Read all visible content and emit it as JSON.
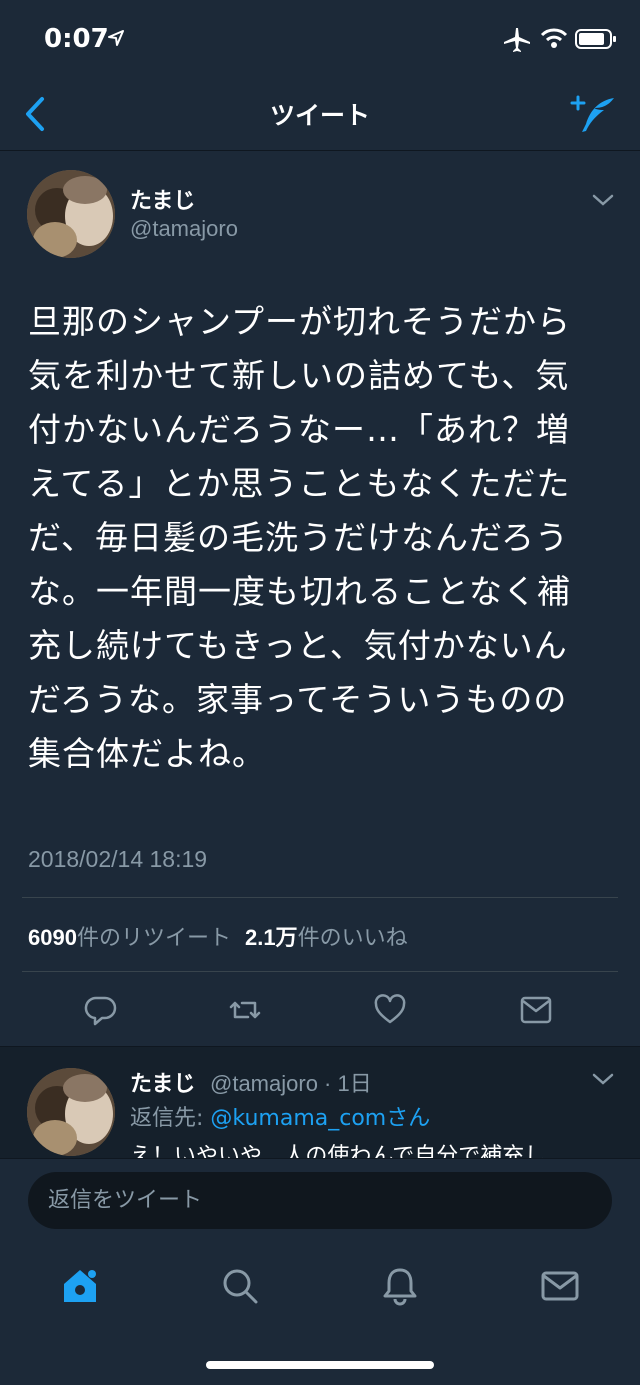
{
  "status_bar": {
    "time": "0:07"
  },
  "nav": {
    "title": "ツイート"
  },
  "tweet": {
    "author_name": "たまじ",
    "author_handle": "@tamajoro",
    "text": "旦那のシャンプーが切れそうだから気を利かせて新しいの詰めても、気付かないんだろうなー…「あれ？増えてる」とか思うこともなくただただ、毎日髪の毛洗うだけなんだろうな。一年間一度も切れることなく補充し続けてもきっと、気付かないんだろうな。家事ってそういうものの集合体だよね。",
    "date": "2018/02/14 18:19",
    "retweet_count": "6090",
    "retweet_label": "件のリツイート",
    "like_count": "2.1万",
    "like_label": "件のいいね"
  },
  "reply": {
    "author_name": "たまじ",
    "handle_time": "@tamajoro · 1日",
    "reply_to_label": "返信先: ",
    "reply_to_user": "@kumama_comさん",
    "text": "え！いやいや、人の使わんで自分で補充し"
  },
  "reply_bar": {
    "placeholder": "返信をツイート"
  },
  "colors": {
    "accent": "#1da1f2",
    "background": "#15202b",
    "panel": "#1c2938",
    "muted": "#8899a6"
  },
  "icons": [
    "location-arrow-icon",
    "airplane-icon",
    "wifi-icon",
    "battery-icon",
    "back-chevron-icon",
    "compose-tweet-icon",
    "chevron-down-icon",
    "reply-icon",
    "retweet-icon",
    "like-icon",
    "share-icon",
    "home-icon",
    "search-icon",
    "notifications-icon",
    "messages-icon"
  ]
}
